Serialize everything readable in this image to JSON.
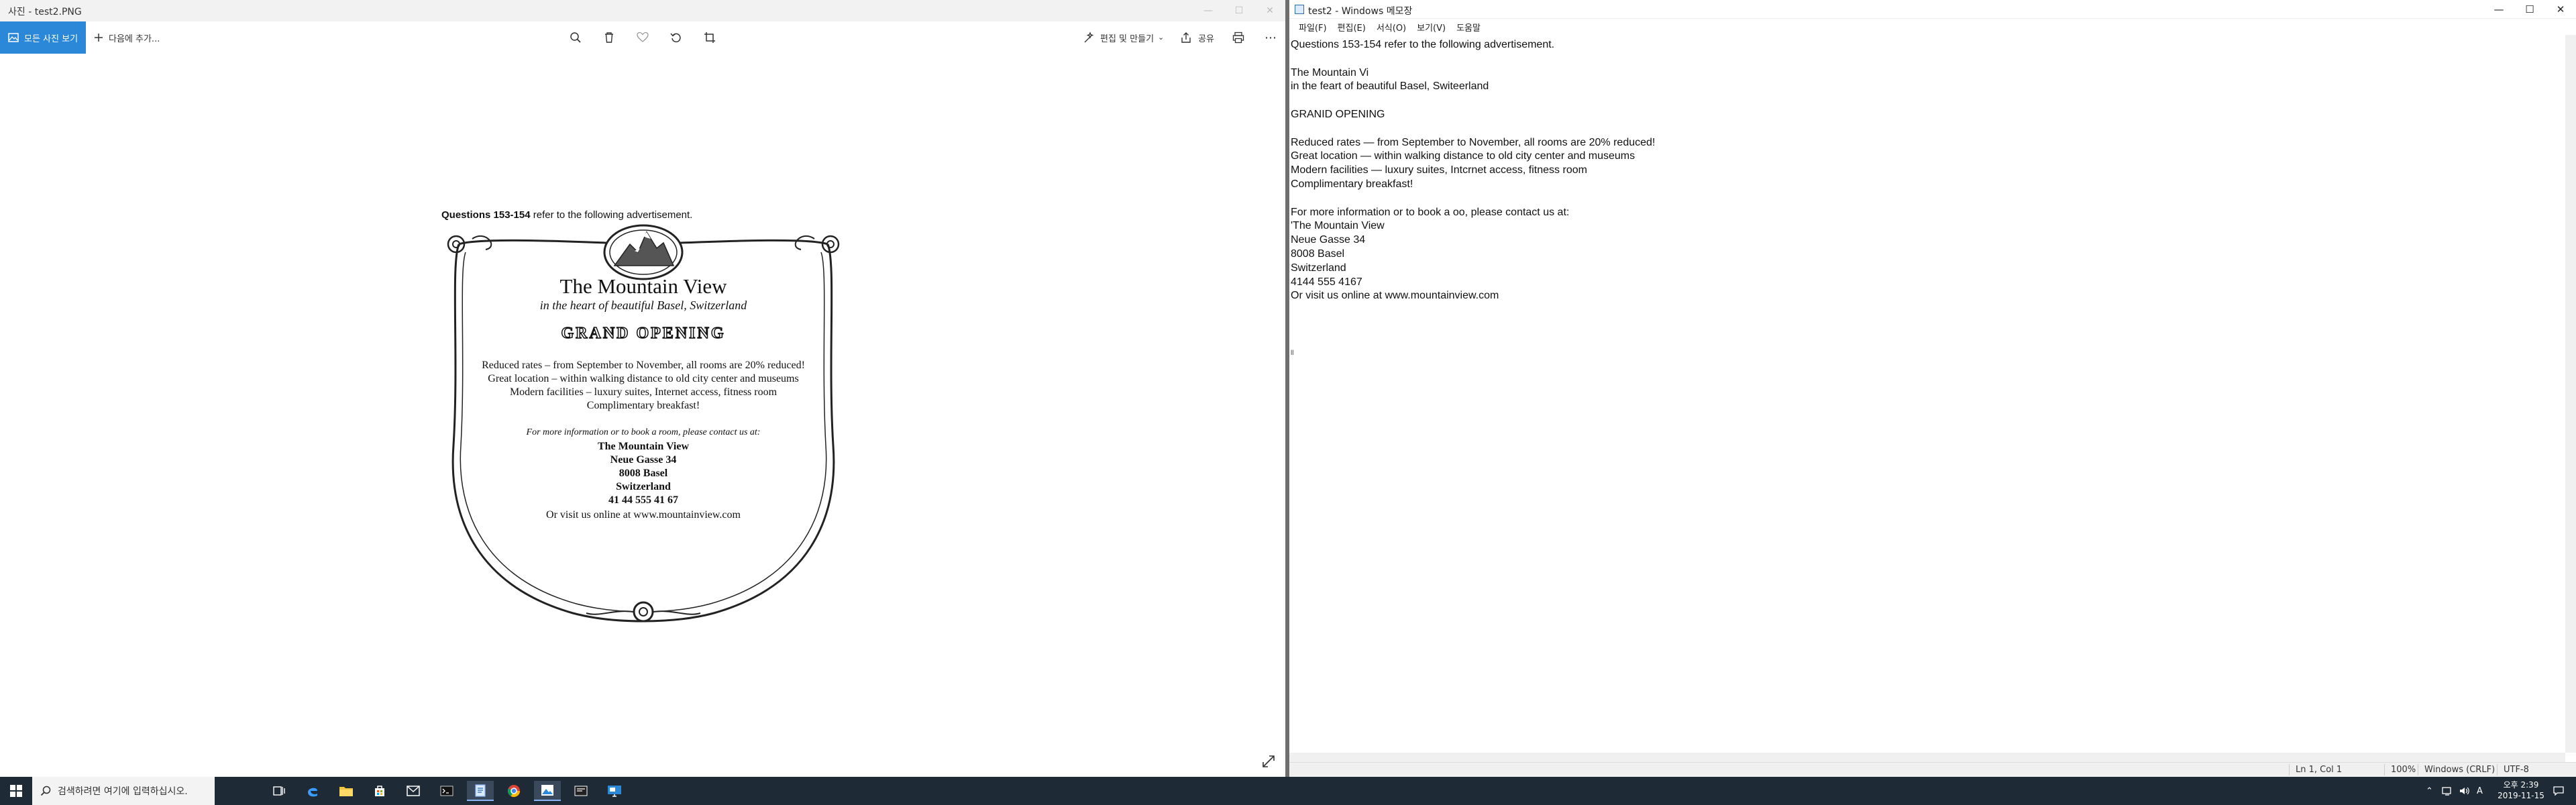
{
  "photos": {
    "title": "사진 - test2.PNG",
    "all_photos_label": "모든 사진 보기",
    "add_to_label": "다음에 추가...",
    "edit_create_label": "편집 및 만들기",
    "share_label": "공유",
    "ad": {
      "question_bold": "Questions 153-154",
      "question_rest": " refer to the following advertisement.",
      "hotel_name": "The Mountain View",
      "tagline": "in the heart of beautiful Basel, Switzerland",
      "headline": "GRAND OPENING",
      "line1": "Reduced rates – from September to November, all rooms are 20% reduced!",
      "line2": "Great location – within walking distance to old city center and museums",
      "line3": "Modern facilities – luxury suites, Internet access, fitness room",
      "line4": "Complimentary breakfast!",
      "contact_intro": "For more information or to book a room, please contact us at:",
      "addr1": "The Mountain View",
      "addr2": "Neue Gasse 34",
      "addr3": "8008 Basel",
      "addr4": "Switzerland",
      "phone": "41 44 555 41 67",
      "web": "Or visit us online at www.mountainview.com"
    }
  },
  "notepad": {
    "title": "test2 - Windows 메모장",
    "menu": [
      "파일(F)",
      "편집(E)",
      "서식(O)",
      "보기(V)",
      "도움말"
    ],
    "content": "Questions 153-154 refer to the following advertisement.\n\nThe Mountain Vi\nin the feart of beautiful Basel, Switeerland\n\nGRANID OPENING\n\nReduced rates — from September to November, all rooms are 20% reduced!\nGreat location — within walking distance to old city center and museums\nModern facilities — luxury suites, Intcrnet access, fitness room\nComplimentary breakfast!\n\nFor more information or to book a oo, please contact us at:\n'The Mountain View\nNeue Gasse 34\n8008 Basel\nSwitzerland\n4144 555 4167\nOr visit us online at www.mountainview.com\n\n\n\n",
    "trailing_char": "ll",
    "status": {
      "position": "Ln 1, Col 1",
      "zoom": "100%",
      "line_ending": "Windows (CRLF)",
      "encoding": "UTF-8"
    }
  },
  "taskbar": {
    "search_placeholder": "검색하려면 여기에 입력하십시오.",
    "time": "오후 2:39",
    "date": "2019-11-15",
    "ime": "A"
  },
  "colors": {
    "accent": "#2b88d8",
    "taskbar": "#1e2a36"
  }
}
